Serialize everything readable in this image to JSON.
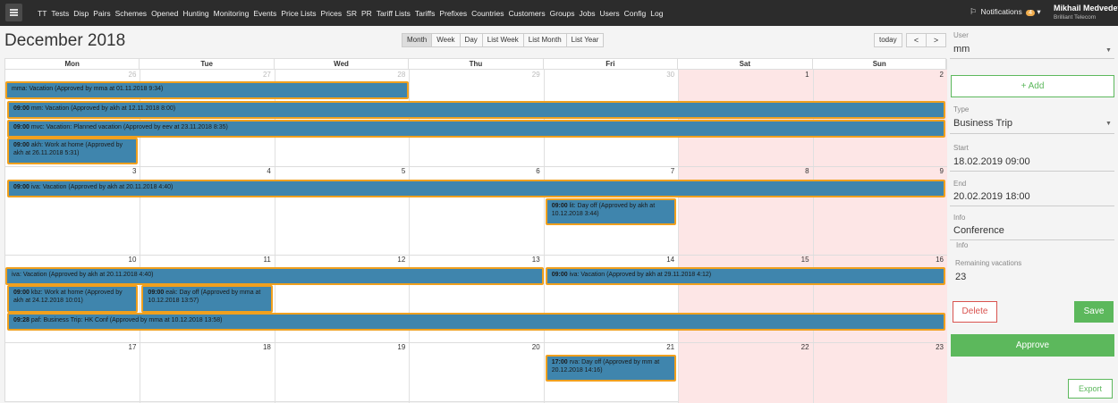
{
  "nav": {
    "items": [
      "TT",
      "Tests",
      "Disp",
      "Pairs",
      "Schemes",
      "Opened",
      "Hunting",
      "Monitoring",
      "Events",
      "Price Lists",
      "Prices",
      "SR",
      "PR",
      "Tariff Lists",
      "Tariffs",
      "Prefixes",
      "Countries",
      "Customers",
      "Groups",
      "Jobs",
      "Users",
      "Config",
      "Log"
    ],
    "notifications_label": "Notifications",
    "notifications_count": "4",
    "user_name": "Mikhail Medvedev",
    "user_company": "Brilliant Telecom"
  },
  "calendar": {
    "title": "December 2018",
    "views": [
      "Month",
      "Week",
      "Day",
      "List Week",
      "List Month",
      "List Year"
    ],
    "active_view": "Month",
    "today_label": "today",
    "prev_label": "<",
    "next_label": ">",
    "day_headers": [
      "Mon",
      "Tue",
      "Wed",
      "Thu",
      "Fri",
      "Sat",
      "Sun"
    ],
    "weekend_color": "#fde6e6",
    "event_color": "#3f85ad",
    "event_border_color": "#f0a01e",
    "weeks": [
      {
        "days": [
          "26",
          "27",
          "28",
          "29",
          "30",
          "1",
          "2"
        ],
        "other_month": [
          true,
          true,
          true,
          true,
          true,
          false,
          false
        ]
      },
      {
        "days": [
          "3",
          "4",
          "5",
          "6",
          "7",
          "8",
          "9"
        ],
        "other_month": [
          false,
          false,
          false,
          false,
          false,
          false,
          false
        ]
      },
      {
        "days": [
          "10",
          "11",
          "12",
          "13",
          "14",
          "15",
          "16"
        ],
        "other_month": [
          false,
          false,
          false,
          false,
          false,
          false,
          false
        ]
      },
      {
        "days": [
          "17",
          "18",
          "19",
          "20",
          "21",
          "22",
          "23"
        ],
        "other_month": [
          false,
          false,
          false,
          false,
          false,
          false,
          false
        ]
      }
    ],
    "events": [
      {
        "id": "e1",
        "time": "",
        "text": "mma: Vacation (Approved by mma at 01.11.2018 9:34)"
      },
      {
        "id": "e2",
        "time": "09:00",
        "text": "mm: Vacation (Approved by akh at 12.11.2018 8:00)"
      },
      {
        "id": "e3",
        "time": "09:00",
        "text": "mvc: Vacation: Planned vacation (Approved by eev at 23.11.2018 8:35)"
      },
      {
        "id": "e4",
        "time": "09:00",
        "text": "akh: Work at home (Approved by akh at 26.11.2018 5:31)"
      },
      {
        "id": "e5",
        "time": "09:00",
        "text": "iva: Vacation (Approved by akh at 20.11.2018 4:40)"
      },
      {
        "id": "e6",
        "time": "09:00",
        "text": "lit: Day off (Approved by akh at 10.12.2018 3:44)"
      },
      {
        "id": "e7",
        "time": "",
        "text": "iva: Vacation (Approved by akh at 20.11.2018 4:40)"
      },
      {
        "id": "e8",
        "time": "09:00",
        "text": "iva: Vacation (Approved by akh at 29.11.2018 4:12)"
      },
      {
        "id": "e9",
        "time": "09:00",
        "text": "kbz: Work at home (Approved by akh at 24.12.2018 10:01)"
      },
      {
        "id": "e10",
        "time": "09:00",
        "text": "eak: Day off (Approved by mma at 10.12.2018 13:57)"
      },
      {
        "id": "e11",
        "time": "09:28",
        "text": "paf: Business Trip: HK Conf (Approved by mma at 10.12.2018 13:58)"
      },
      {
        "id": "e12",
        "time": "17:00",
        "text": "rva: Day off (Approved by mm at 20.12.2018 14:16)"
      }
    ]
  },
  "sidebar": {
    "user_label": "User",
    "user_value": "mm",
    "add_label": "+ Add",
    "type_label": "Type",
    "type_value": "Business Trip",
    "start_label": "Start",
    "start_value": "18.02.2019 09:00",
    "end_label": "End",
    "end_value": "20.02.2019 18:00",
    "info_label": "Info",
    "info_value": "Conference",
    "info_hint": "Info",
    "remaining_label": "Remaining vacations",
    "remaining_value": "23",
    "delete_label": "Delete",
    "save_label": "Save",
    "approve_label": "Approve",
    "export_label": "Export"
  }
}
